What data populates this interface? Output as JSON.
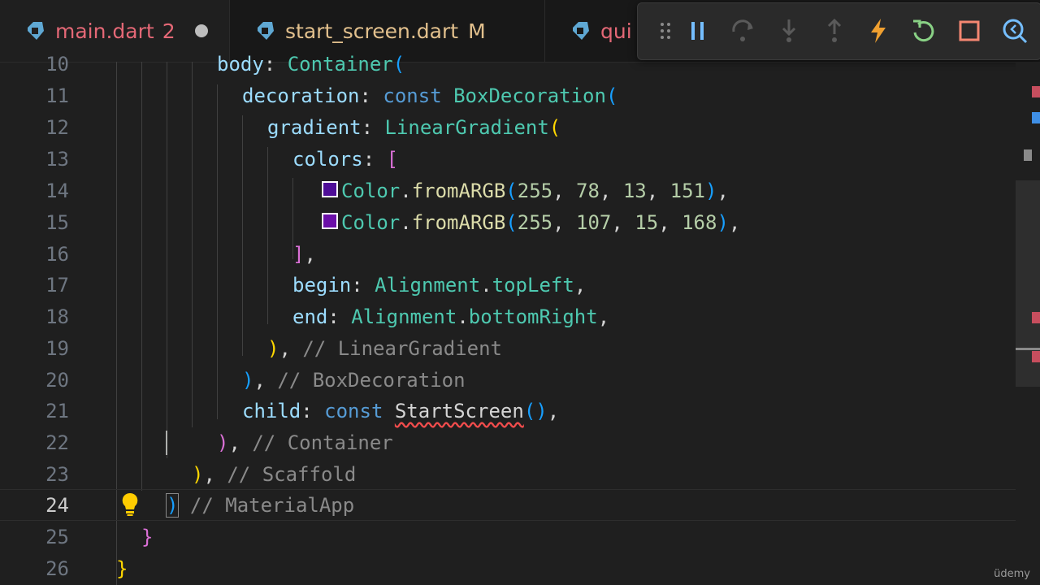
{
  "tabs": [
    {
      "label": "main.dart",
      "badge": "2",
      "dirty": true
    },
    {
      "label": "start_screen.dart",
      "badge": "M"
    },
    {
      "label": "qui"
    }
  ],
  "debug_toolbar": {
    "buttons": [
      "drag-handle",
      "pause",
      "step-over",
      "step-into",
      "step-out",
      "hot-reload",
      "restart",
      "stop",
      "devtools"
    ]
  },
  "editor": {
    "current_line": 24,
    "lines": [
      {
        "num": "10",
        "tokens": [
          "body",
          ": ",
          "Container",
          "("
        ]
      },
      {
        "num": "11",
        "tokens": [
          "decoration",
          ": ",
          "const",
          " ",
          "BoxDecoration",
          "("
        ]
      },
      {
        "num": "12",
        "tokens": [
          "gradient",
          ": ",
          "LinearGradient",
          "("
        ]
      },
      {
        "num": "13",
        "tokens": [
          "colors",
          ": ",
          "["
        ]
      },
      {
        "num": "14",
        "tokens": [
          "Color",
          ".",
          "fromARGB",
          "(",
          "255",
          ", ",
          "78",
          ", ",
          "13",
          ", ",
          "151",
          ")",
          ","
        ]
      },
      {
        "num": "15",
        "tokens": [
          "Color",
          ".",
          "fromARGB",
          "(",
          "255",
          ", ",
          "107",
          ", ",
          "15",
          ", ",
          "168",
          ")",
          ","
        ]
      },
      {
        "num": "16",
        "tokens": [
          "]",
          ","
        ]
      },
      {
        "num": "17",
        "tokens": [
          "begin",
          ": ",
          "Alignment",
          ".",
          "topLeft",
          ","
        ]
      },
      {
        "num": "18",
        "tokens": [
          "end",
          ": ",
          "Alignment",
          ".",
          "bottomRight",
          ","
        ]
      },
      {
        "num": "19",
        "tokens": [
          ")",
          ", ",
          "// LinearGradient"
        ]
      },
      {
        "num": "20",
        "tokens": [
          ")",
          ", ",
          "// BoxDecoration"
        ]
      },
      {
        "num": "21",
        "tokens": [
          "child",
          ": ",
          "const",
          " ",
          "StartScreen",
          "()",
          ","
        ]
      },
      {
        "num": "22",
        "tokens": [
          ")",
          ", ",
          "// Container"
        ]
      },
      {
        "num": "23",
        "tokens": [
          ")",
          ", ",
          "// Scaffold"
        ]
      },
      {
        "num": "24",
        "tokens": [
          ")",
          " ",
          "// MaterialApp"
        ]
      },
      {
        "num": "25",
        "tokens": [
          "}"
        ]
      },
      {
        "num": "26",
        "tokens": [
          "}"
        ]
      }
    ],
    "swatches": [
      "#4e0d97",
      "#6b0fa8"
    ]
  },
  "watermark": "üdemy"
}
